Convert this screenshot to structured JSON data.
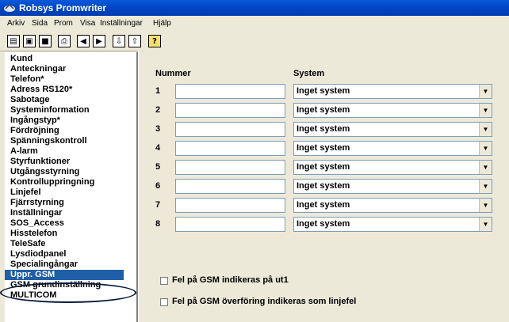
{
  "window": {
    "title": "Robsys Promwriter"
  },
  "menu": [
    "Arkiv",
    "Sida",
    "Prom",
    "Visa",
    "Inställningar",
    "Hjälp"
  ],
  "toolbar": {
    "help_glyph": "?"
  },
  "sidebar": {
    "items": [
      "Kund",
      "Anteckningar",
      "Telefon*",
      "Adress RS120*",
      "Sabotage",
      "Systeminformation",
      "Ingångstyp*",
      "Fördröjning",
      "Spänningskontroll",
      "A-larm",
      "Styrfunktioner",
      "Utgångsstyrning",
      "Kontrolluppringning",
      "Linjefel",
      "Fjärrstyrning",
      "Inställningar",
      "SOS_Access",
      "Hisstelefon",
      "TeleSafe",
      "Lysdiodpanel",
      "Specialingångar",
      "Uppr. GSM",
      "GSM grundinställning",
      "MULTICOM"
    ],
    "selected": "Uppr. GSM"
  },
  "form": {
    "header_number": "Nummer",
    "header_system": "System",
    "rows": [
      {
        "num": "1",
        "value": "",
        "system": "Inget system"
      },
      {
        "num": "2",
        "value": "",
        "system": "Inget system"
      },
      {
        "num": "3",
        "value": "",
        "system": "Inget system"
      },
      {
        "num": "4",
        "value": "",
        "system": "Inget system"
      },
      {
        "num": "5",
        "value": "",
        "system": "Inget system"
      },
      {
        "num": "6",
        "value": "",
        "system": "Inget system"
      },
      {
        "num": "7",
        "value": "",
        "system": "Inget system"
      },
      {
        "num": "8",
        "value": "",
        "system": "Inget system"
      }
    ],
    "check1": "Fel på GSM indikeras på ut1",
    "check2": "Fel på GSM överföring indikeras som linjefel"
  }
}
